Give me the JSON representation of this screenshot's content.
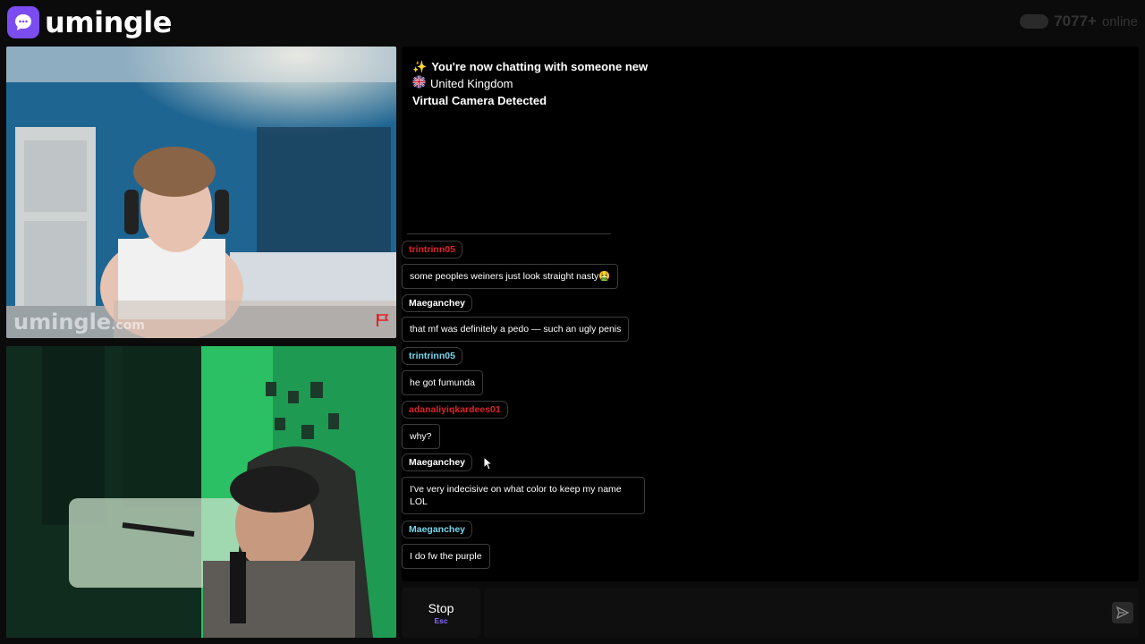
{
  "header": {
    "logo_text": "umingle",
    "online_count": "7077+",
    "online_label": "online"
  },
  "videos": {
    "watermark": "umingle",
    "watermark_suffix": ".com"
  },
  "chat": {
    "intro": {
      "status": "You're now chatting with someone new",
      "country": "United Kingdom",
      "notice": "Virtual Camera Detected"
    },
    "messages": [
      {
        "user": "trintrinn05",
        "user_color": "#e0242b",
        "text": "some peoples weiners just look straight nasty🤮"
      },
      {
        "user": "Maeganchey",
        "user_color": "#ffffff",
        "text": "that mf was definitely a pedo — such an ugly penis"
      },
      {
        "user": "trintrinn05",
        "user_color": "#79d6ec",
        "text": "he got fumunda"
      },
      {
        "user": "adanaliyiqkardees01",
        "user_color": "#e0242b",
        "text": "why?"
      },
      {
        "user": "Maeganchey",
        "user_color": "#ffffff",
        "text": "I've very indecisive on what color to keep my name LOL"
      },
      {
        "user": "Maeganchey",
        "user_color": "#79d6ec",
        "text": "I do fw the purple"
      }
    ]
  },
  "controls": {
    "stop_label": "Stop",
    "stop_key": "Esc",
    "input_value": "",
    "input_placeholder": ""
  },
  "colors": {
    "brand": "#7b4cf0",
    "background": "#0b0b0b",
    "chat_background": "#000000"
  }
}
